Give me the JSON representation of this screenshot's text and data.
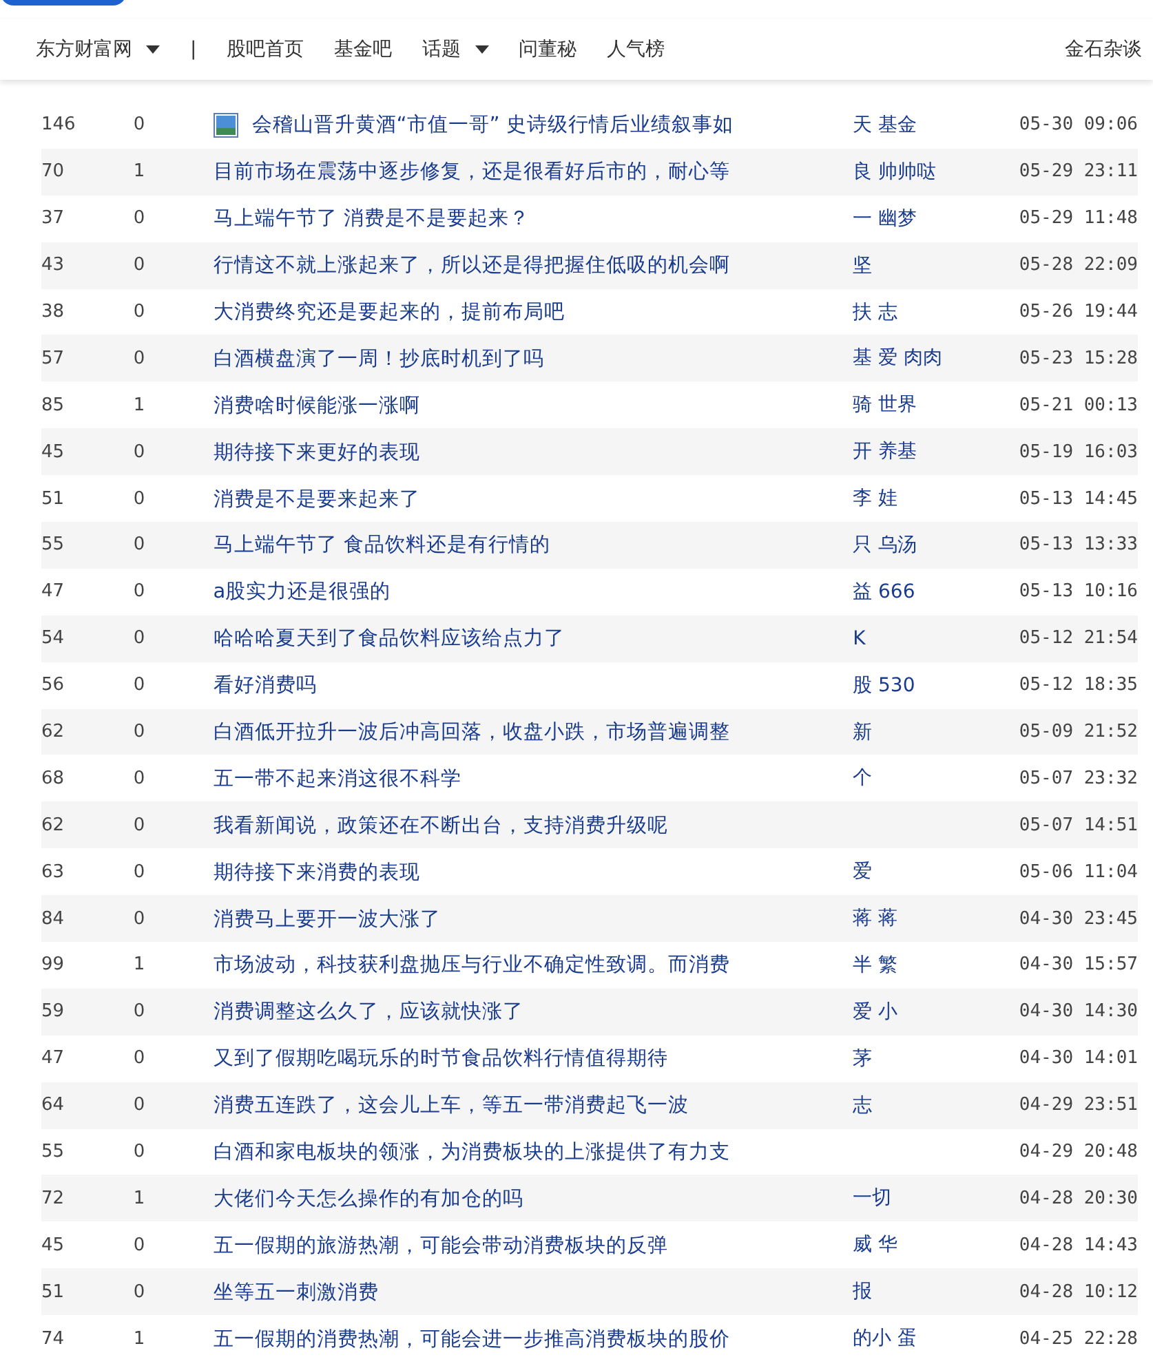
{
  "nav": {
    "items": [
      {
        "label": "东方财富网",
        "dropdown": true
      },
      {
        "label": "|",
        "dropdown": false
      },
      {
        "label": "股吧首页",
        "dropdown": false
      },
      {
        "label": "基金吧",
        "dropdown": false
      },
      {
        "label": "话题",
        "dropdown": true
      },
      {
        "label": "问董秘",
        "dropdown": false
      },
      {
        "label": "人气榜",
        "dropdown": false
      }
    ],
    "right": "金石杂谈"
  },
  "posts": [
    {
      "reads": "146",
      "comments": "0",
      "title": "会稽山晋升黄酒“市值一哥” 史诗级行情后业绩叙事如",
      "has_image": true,
      "author": "天 基金",
      "time": "05-30 09:06"
    },
    {
      "reads": "70",
      "comments": "1",
      "title": "目前市场在震荡中逐步修复，还是很看好后市的，耐心等",
      "has_image": false,
      "author": "良 帅帅哒",
      "time": "05-29 23:11"
    },
    {
      "reads": "37",
      "comments": "0",
      "title": "马上端午节了 消费是不是要起来？",
      "has_image": false,
      "author": "一 幽梦",
      "time": "05-29 11:48"
    },
    {
      "reads": "43",
      "comments": "0",
      "title": "行情这不就上涨起来了，所以还是得把握住低吸的机会啊",
      "has_image": false,
      "author": "坚",
      "time": "05-28 22:09"
    },
    {
      "reads": "38",
      "comments": "0",
      "title": "大消费终究还是要起来的，提前布局吧",
      "has_image": false,
      "author": "扶 志",
      "time": "05-26 19:44"
    },
    {
      "reads": "57",
      "comments": "0",
      "title": "白酒横盘演了一周！抄底时机到了吗",
      "has_image": false,
      "author": "基 爱 肉肉",
      "time": "05-23 15:28"
    },
    {
      "reads": "85",
      "comments": "1",
      "title": "消费啥时候能涨一涨啊",
      "has_image": false,
      "author": "骑 世界",
      "time": "05-21 00:13"
    },
    {
      "reads": "45",
      "comments": "0",
      "title": "期待接下来更好的表现",
      "has_image": false,
      "author": "开 养基",
      "time": "05-19 16:03"
    },
    {
      "reads": "51",
      "comments": "0",
      "title": "消费是不是要来起来了",
      "has_image": false,
      "author": "李 娃",
      "time": "05-13 14:45"
    },
    {
      "reads": "55",
      "comments": "0",
      "title": "马上端午节了 食品饮料还是有行情的",
      "has_image": false,
      "author": "只 乌汤",
      "time": "05-13 13:33"
    },
    {
      "reads": "47",
      "comments": "0",
      "title": "a股实力还是很强的",
      "has_image": false,
      "author": "益 666",
      "time": "05-13 10:16"
    },
    {
      "reads": "54",
      "comments": "0",
      "title": "哈哈哈夏天到了食品饮料应该给点力了",
      "has_image": false,
      "author": "K",
      "time": "05-12 21:54"
    },
    {
      "reads": "56",
      "comments": "0",
      "title": "看好消费吗",
      "has_image": false,
      "author": "股 530",
      "time": "05-12 18:35"
    },
    {
      "reads": "62",
      "comments": "0",
      "title": "白酒低开拉升一波后冲高回落，收盘小跌，市场普遍调整",
      "has_image": false,
      "author": "新",
      "time": "05-09 21:52"
    },
    {
      "reads": "68",
      "comments": "0",
      "title": "五一带不起来消这很不科学",
      "has_image": false,
      "author": "个",
      "time": "05-07 23:32"
    },
    {
      "reads": "62",
      "comments": "0",
      "title": "我看新闻说，政策还在不断出台，支持消费升级呢",
      "has_image": false,
      "time": "05-07 14:51"
    },
    {
      "reads": "63",
      "comments": "0",
      "title": "期待接下来消费的表现",
      "has_image": false,
      "author": "爱",
      "time": "05-06 11:04"
    },
    {
      "reads": "84",
      "comments": "0",
      "title": "消费马上要开一波大涨了",
      "has_image": false,
      "author": "蒋 蒋",
      "time": "04-30 23:45"
    },
    {
      "reads": "99",
      "comments": "1",
      "title": "市场波动，科技获利盘抛压与行业不确定性致调。而消费",
      "has_image": false,
      "author": "半 繁",
      "time": "04-30 15:57"
    },
    {
      "reads": "59",
      "comments": "0",
      "title": "消费调整这么久了，应该就快涨了",
      "has_image": false,
      "author": "爱 小",
      "time": "04-30 14:30"
    },
    {
      "reads": "47",
      "comments": "0",
      "title": "又到了假期吃喝玩乐的时节食品饮料行情值得期待",
      "has_image": false,
      "author": "茅",
      "time": "04-30 14:01"
    },
    {
      "reads": "64",
      "comments": "0",
      "title": "消费五连跌了，这会儿上车，等五一带消费起飞一波",
      "has_image": false,
      "author": "志",
      "time": "04-29 23:51"
    },
    {
      "reads": "55",
      "comments": "0",
      "title": "白酒和家电板块的领涨，为消费板块的上涨提供了有力支",
      "has_image": false,
      "time": "04-29 20:48"
    },
    {
      "reads": "72",
      "comments": "1",
      "title": "大佬们今天怎么操作的有加仓的吗",
      "has_image": false,
      "author": "一切",
      "time": "04-28 20:30"
    },
    {
      "reads": "45",
      "comments": "0",
      "title": "五一假期的旅游热潮，可能会带动消费板块的反弹",
      "has_image": false,
      "author": "威 华",
      "time": "04-28 14:43"
    },
    {
      "reads": "51",
      "comments": "0",
      "title": "坐等五一刺激消费",
      "has_image": false,
      "author": "报",
      "time": "04-28 10:12"
    },
    {
      "reads": "74",
      "comments": "1",
      "title": "五一假期的消费热潮，可能会进一步推高消费板块的股价",
      "has_image": false,
      "author": "的小 蛋",
      "time": "04-25 22:28"
    }
  ]
}
